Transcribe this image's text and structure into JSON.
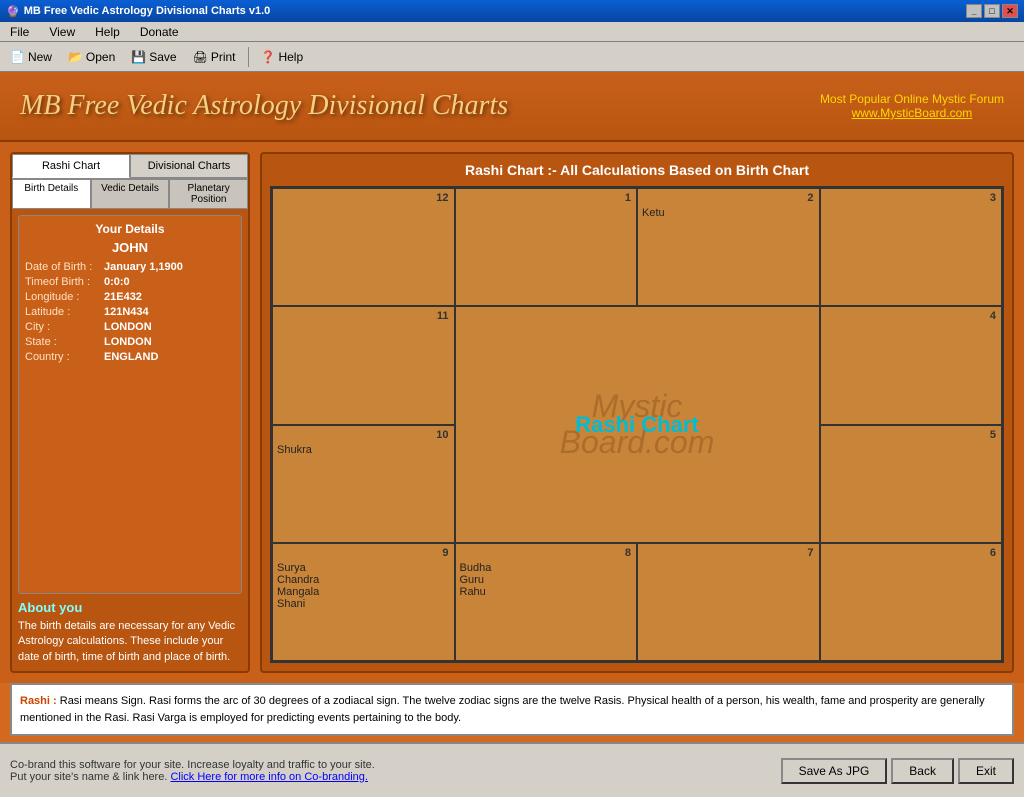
{
  "window": {
    "title": "MB Free Vedic Astrology Divisional Charts v1.0",
    "controls": [
      "minimize",
      "maximize",
      "close"
    ]
  },
  "menubar": {
    "items": [
      "File",
      "View",
      "Help",
      "Donate"
    ]
  },
  "toolbar": {
    "buttons": [
      {
        "label": "New",
        "icon": "new-icon"
      },
      {
        "label": "Open",
        "icon": "open-icon"
      },
      {
        "label": "Save",
        "icon": "save-icon"
      },
      {
        "label": "Print",
        "icon": "print-icon"
      },
      {
        "label": "Help",
        "icon": "help-icon"
      }
    ]
  },
  "header": {
    "title": "MB Free Vedic Astrology Divisional Charts",
    "tagline": "Most Popular Online Mystic Forum",
    "website": "www.MysticBoard.com"
  },
  "left_panel": {
    "tabs": [
      {
        "label": "Rashi Chart",
        "active": true
      },
      {
        "label": "Divisional Charts",
        "active": false
      }
    ],
    "sub_tabs": [
      {
        "label": "Birth Details",
        "active": true
      },
      {
        "label": "Vedic Details",
        "active": false
      },
      {
        "label": "Planetary Position",
        "active": false
      }
    ],
    "details": {
      "section_title": "Your Details",
      "name": "JOHN",
      "fields": [
        {
          "label": "Date of Birth :",
          "value": "January 1,1900"
        },
        {
          "label": "Timeof Birth :",
          "value": "0:0:0"
        },
        {
          "label": "Longitude :",
          "value": "21E432"
        },
        {
          "label": "Latitude :",
          "value": "121N434"
        },
        {
          "label": "City :",
          "value": "LONDON"
        },
        {
          "label": "State :",
          "value": "LONDON"
        },
        {
          "label": "Country :",
          "value": "ENGLAND"
        }
      ]
    },
    "about": {
      "title": "About you",
      "text": "The birth details are necessary for any Vedic Astrology calculations. These include your date of birth, time of birth and place of birth."
    }
  },
  "chart": {
    "title": "Rashi Chart :- All Calculations Based on Birth Chart",
    "center_label": "Rashi Chart",
    "watermark": "Mystic\nBoard.com",
    "cells": [
      {
        "position": "top-left-1",
        "num": "12",
        "planets": ""
      },
      {
        "position": "top-2",
        "num": "1",
        "planets": ""
      },
      {
        "position": "top-3",
        "num": "2",
        "planets": "Ketu"
      },
      {
        "position": "top-right-4",
        "num": "3",
        "planets": ""
      },
      {
        "position": "mid-left-5",
        "num": "11",
        "planets": ""
      },
      {
        "position": "mid-right-6",
        "num": "4",
        "planets": ""
      },
      {
        "position": "bot-left-7",
        "num": "10",
        "planets": "Shukra"
      },
      {
        "position": "bot-right-8",
        "num": "5",
        "planets": ""
      },
      {
        "position": "bottom-1",
        "num": "9",
        "planets": "Surya\nChandra\nMangala\nShani"
      },
      {
        "position": "bottom-2",
        "num": "8",
        "planets": "Budha\nGuru\nRahu"
      },
      {
        "position": "bottom-3",
        "num": "7",
        "planets": ""
      },
      {
        "position": "bottom-4",
        "num": "6",
        "planets": ""
      }
    ]
  },
  "info_panel": {
    "title": "Rashi :",
    "text": "Rasi means Sign. Rasi forms the arc of 30 degrees of a zodiacal sign. The twelve zodiac signs are the twelve Rasis. Physical health of a person, his wealth, fame and prosperity are generally mentioned in the Rasi. Rasi Varga is employed for predicting events pertaining to the body."
  },
  "bottom_bar": {
    "cobrand_text1": "Co-brand this software for your site. Increase loyalty and traffic to your site.",
    "cobrand_text2": "Put your site's name & link here.",
    "cobrand_link": "Click Here for more info on Co-branding.",
    "buttons": [
      "Save As JPG",
      "Back",
      "Exit"
    ]
  }
}
